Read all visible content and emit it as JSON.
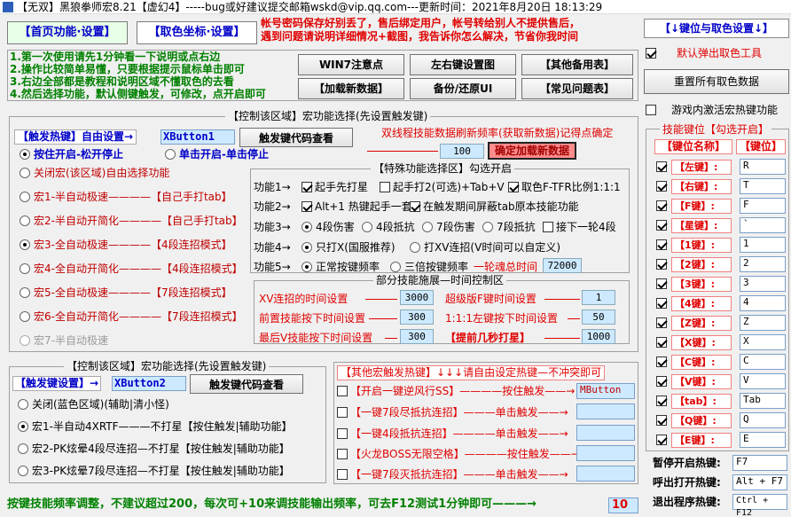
{
  "title": "【无双】黑狼拳师宏8.21【虚幻4】-----bug或好建议提交邮箱wskd@vip.qq.com---更新时间：2021年8月20日 18:13:29",
  "tabs": {
    "home": "【首页功能·设置】",
    "pick": "【取色坐标·设置】"
  },
  "notice": {
    "l1": "帐号密码保存好别丢了，售后绑定用户，帐号转给别人不提供售后，",
    "l2": "遇到问题请说明详细情况+截图，我告诉你怎么解决，节省你我时间"
  },
  "steps": [
    "1.第一次使用请先1分钟看一下说明或点右边",
    "2.操作比较简单易懂，只要根据提示鼠标单击即可",
    "3.右边全部都是教程和说明区域不懂取色的去看",
    "4.然后选择功能，默认侧键触发，可修改，点开启即可"
  ],
  "buttons": {
    "win7": "WIN7注意点",
    "lr": "左右键设置图",
    "other": "【其他备用表】",
    "add": "【加载新数据】",
    "backup": "备份/还原UI",
    "faq": "【常见问题表】",
    "code1": "触发键代码查看",
    "code2": "触发键代码查看",
    "load": "确定加载新数据",
    "reset": "重置所有取色数据"
  },
  "group1": {
    "title": "【控制该区域】宏功能选择(先设置触发键)",
    "trigger_label": "【触发热键】自由设置→",
    "trigger_key": "XButton1",
    "mode_hold": "按住开启-松开停止",
    "mode_click": "单击开启-单击停止",
    "macros": [
      {
        "name": "关闭宏(该区域)自由选择功能",
        "tag": ""
      },
      {
        "name": "宏1-半自动极速————",
        "tag": "【自己手打tab】"
      },
      {
        "name": "宏2-半自动开简化————",
        "tag": "【自己手打tab】"
      },
      {
        "name": "宏3-全自动极速————",
        "tag": "【4段连招模式】"
      },
      {
        "name": "宏4-全自动开简化————",
        "tag": "【4段连招模式】"
      },
      {
        "name": "宏5-全自动极速————",
        "tag": "【7段连招模式】"
      },
      {
        "name": "宏6-全自动开简化————",
        "tag": "【7段连招模式】"
      },
      {
        "name": "宏7-半自动极速",
        "tag": ""
      }
    ],
    "refresh_label": "双线程技能数据刷新频率(获取新数据)记得点确定",
    "refresh_value": "100"
  },
  "special": {
    "title": "【特殊功能选择区】勾选开启",
    "f1": {
      "label": "功能1→",
      "a": "起手先打星",
      "b": "起手打2(可选)+Tab+V",
      "c": "取色F-TFR比例1:1:1"
    },
    "f2": {
      "label": "功能2→",
      "a": "Alt+1 热键起手一套",
      "b": "在触发期间屏蔽tab原本技能功能"
    },
    "f3": {
      "label": "功能3→",
      "a": "4段伤害",
      "b": "4段抵抗",
      "c": "7段伤害",
      "d": "7段抵抗",
      "e": "接下一轮4段"
    },
    "f4": {
      "label": "功能4→",
      "a": "只打X(国服推荐)",
      "b": "打XV连招(V时间可以自定义)"
    },
    "f5": {
      "label": "功能5→",
      "a": "正常按键频率",
      "b": "三倍按键频率",
      "c": "一轮魂总时间",
      "v": "72000"
    }
  },
  "timing": {
    "title": "部分技能施展—时间控制区",
    "xv": "XV连招的时间设置",
    "xv_v": "3000",
    "pre": "前置技能按下时间设置",
    "pre_v": "300",
    "last": "最后V技能按下时间设置",
    "last_v": "300",
    "super": "超级版F键时间设置",
    "super_v": "1",
    "ratio": "1:1:1左键按下时间设置",
    "ratio_v": "50",
    "star": "【提前几秒打星】",
    "star_v": "1000"
  },
  "group2": {
    "title": "【控制该区域】宏功能选择(先设置触发键)",
    "trigger_label": "【触发键设置】→",
    "trigger_key": "XButton2",
    "opts": [
      "关闭(蓝色区域)(辅助|清小怪)",
      "宏1-半自动4XRTF———不打星【按住触发|辅助功能】",
      "宏2-PK炫晕4段尽连招—不打星【按住触发|辅助功能】",
      "宏3-PK炫晕7段尽连招—不打星【按住触发|辅助功能】"
    ]
  },
  "other": {
    "title": "【其他宏触发热键】↓↓↓请自由设定热键—不冲突即可",
    "items": [
      {
        "name": "【开启一键逆风行SS】",
        "act": "————按住触发——→",
        "key": "MButton"
      },
      {
        "name": "【一键7段尽抵抗连招】",
        "act": "———单击触发——→",
        "key": ""
      },
      {
        "name": "【一键4段抵抗连招】",
        "act": "————单击触发——→",
        "key": ""
      },
      {
        "name": "【火龙BOSS无限空格】",
        "act": "————按住触发——→",
        "key": ""
      },
      {
        "name": "【一键7段灭抵抗连招】",
        "act": "———单击触发——→",
        "key": ""
      }
    ]
  },
  "footer": {
    "text": "按键技能频率调整，不建议超过200，每次可+10来调技能输出频率，可去F12测试1分钟即可———→",
    "value": "10"
  },
  "right": {
    "header": "【↓键位与取色设置↓】",
    "auto_popup": "默认弹出取色工具",
    "ingame": "游戏内激活宏热键功能",
    "keys_title": "技能键位【勾选开启】",
    "col_name": "【键位名称】",
    "col_key": "【键位】",
    "keys": [
      {
        "name": "【左键】:",
        "key": "R"
      },
      {
        "name": "【右键】:",
        "key": "T"
      },
      {
        "name": "【F键】:",
        "key": "F"
      },
      {
        "name": "【星键】:",
        "key": "`"
      },
      {
        "name": "【1键】:",
        "key": "1"
      },
      {
        "name": "【2键】:",
        "key": "2"
      },
      {
        "name": "【3键】:",
        "key": "3"
      },
      {
        "name": "【4键】:",
        "key": "4"
      },
      {
        "name": "【Z键】:",
        "key": "Z"
      },
      {
        "name": "【X键】:",
        "key": "X"
      },
      {
        "name": "【C键】:",
        "key": "C"
      },
      {
        "name": "【V键】:",
        "key": "V"
      },
      {
        "name": "【tab】:",
        "key": "Tab"
      },
      {
        "name": "【Q键】:",
        "key": "Q"
      },
      {
        "name": "【E键】:",
        "key": "E"
      }
    ],
    "hot_pause": "暂停开启热键:",
    "hot_pause_v": "F7",
    "hot_show": "呼出打开热键:",
    "hot_show_v": "Alt + F7",
    "hot_exit": "退出程序热键:",
    "hot_exit_v": "Ctrl + F12"
  }
}
